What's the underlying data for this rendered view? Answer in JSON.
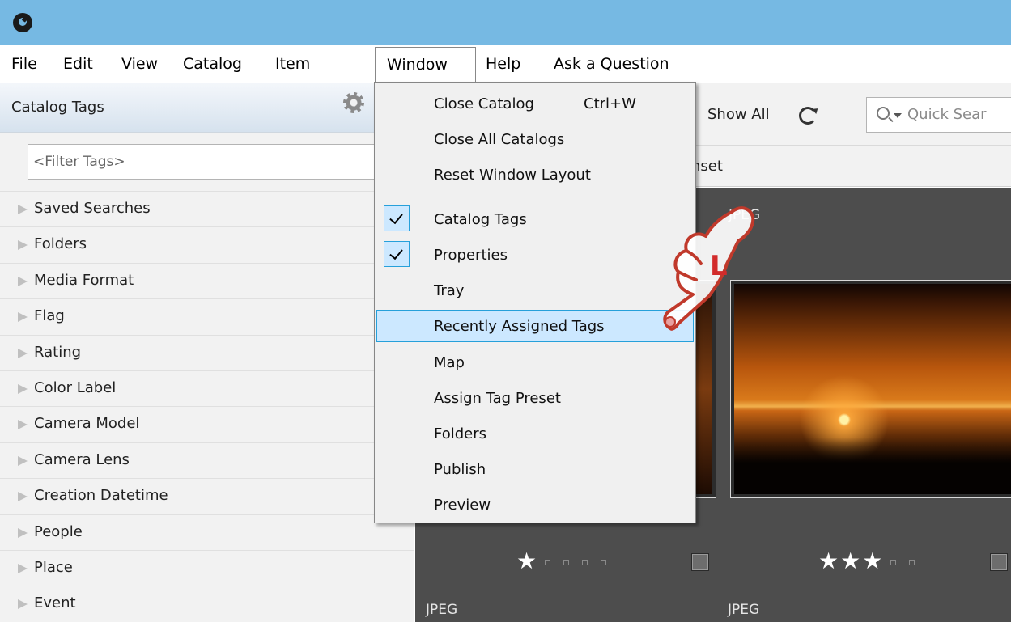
{
  "menubar": {
    "items": [
      "File",
      "Edit",
      "View",
      "Catalog",
      "Item",
      "Window",
      "Help",
      "Ask a Question"
    ],
    "active": "Window"
  },
  "left_panel": {
    "title": "Catalog Tags",
    "filter_placeholder": "<Filter Tags>",
    "tags": [
      "Saved Searches",
      "Folders",
      "Media Format",
      "Flag",
      "Rating",
      "Color Label",
      "Camera Model",
      "Camera Lens",
      "Creation Datetime",
      "People",
      "Place",
      "Event"
    ]
  },
  "toolbar": {
    "show_all_label": "Show All",
    "search_placeholder": "Quick Sear"
  },
  "preset_bar": {
    "text": "nset"
  },
  "grid": {
    "top_labels": [
      "JPEG"
    ],
    "bottom_labels": [
      "JPEG",
      "JPEG"
    ],
    "ratings": [
      1,
      3
    ]
  },
  "window_menu": {
    "group1": [
      {
        "label": "Close Catalog",
        "shortcut": "Ctrl+W"
      },
      {
        "label": "Close All Catalogs"
      },
      {
        "label": "Reset Window Layout"
      }
    ],
    "group2": [
      {
        "label": "Catalog Tags",
        "checked": true
      },
      {
        "label": "Properties",
        "checked": true
      },
      {
        "label": "Tray"
      },
      {
        "label": "Recently Assigned Tags",
        "highlighted": true
      },
      {
        "label": "Map"
      },
      {
        "label": "Assign Tag Preset"
      },
      {
        "label": "Folders"
      },
      {
        "label": "Publish"
      },
      {
        "label": "Preview"
      }
    ]
  },
  "colors": {
    "titlebar": "#76b9e3",
    "menu_highlight": "#cce8ff",
    "menu_highlight_border": "#26a0da",
    "grid_background": "#4d4d4d",
    "hand_outline": "#c0392b"
  },
  "icons": {
    "app": "app-logo-icon",
    "panel_settings": "gear-icon",
    "refresh": "refresh-icon",
    "search": "search-icon",
    "pointer": "hand-pointer-icon"
  },
  "annotation": {
    "hand_letter": "L"
  }
}
